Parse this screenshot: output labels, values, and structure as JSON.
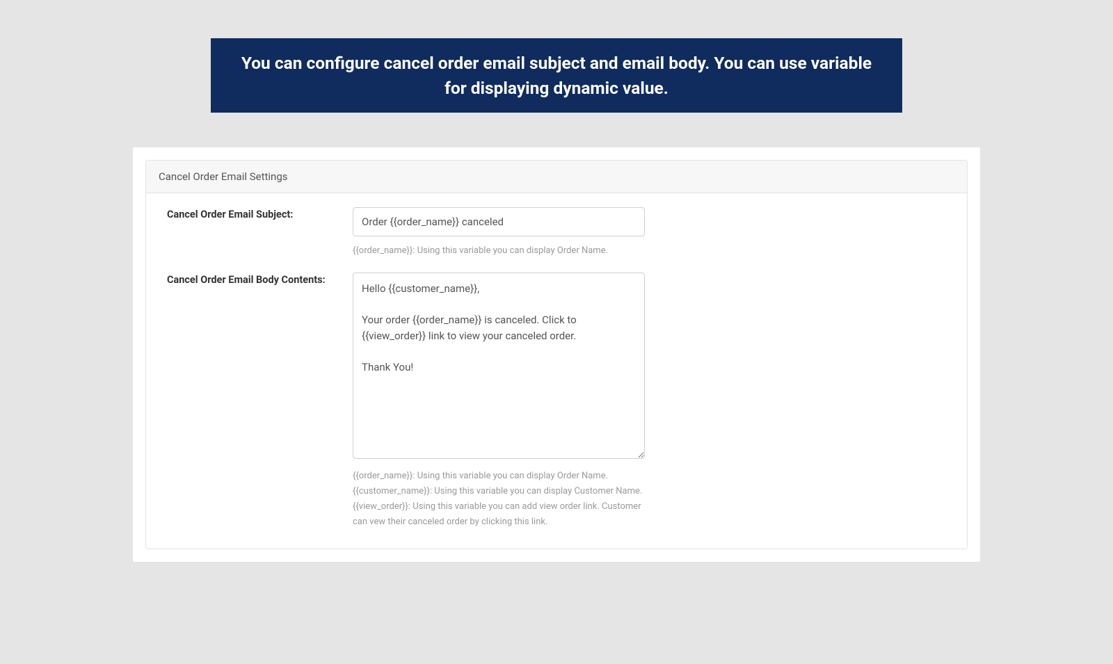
{
  "banner": {
    "text": "You can configure cancel order email subject and email body. You can use variable for displaying dynamic value."
  },
  "panel": {
    "title": "Cancel Order Email Settings"
  },
  "form": {
    "subject": {
      "label": "Cancel Order Email Subject:",
      "value": "Order {{order_name}} canceled",
      "hint": "{{order_name}}: Using this variable you can display Order Name."
    },
    "body": {
      "label": "Cancel Order Email Body Contents:",
      "value": "Hello {{customer_name}},\n\nYour order {{order_name}} is canceled. Click to {{view_order}} link to view your canceled order.\n\nThank You!",
      "hints": [
        "{{order_name}}: Using this variable you can display Order Name.",
        "{{customer_name}}: Using this variable you can display Customer Name.",
        "{{view_order}}: Using this variable you can add view order link. Customer can vew their canceled order by clicking this link."
      ]
    }
  }
}
